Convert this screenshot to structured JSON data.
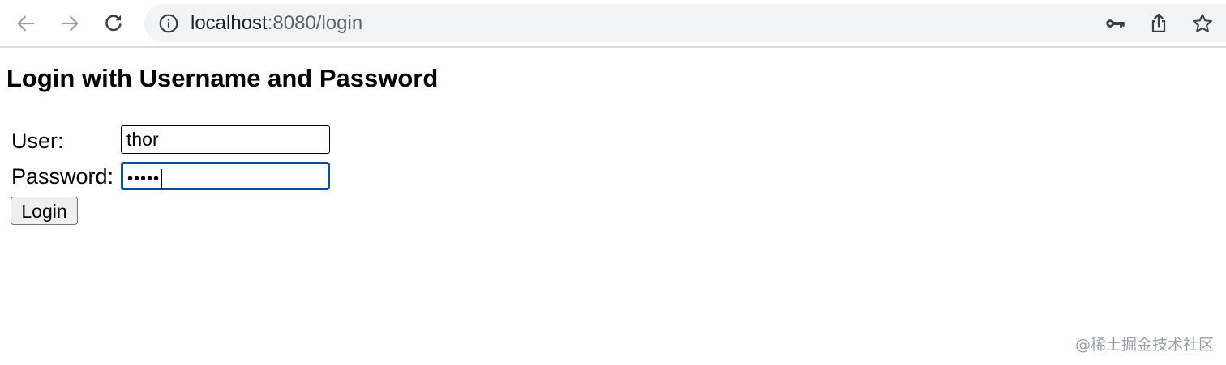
{
  "browser": {
    "url_host": "localhost",
    "url_rest": ":8080/login",
    "icons": {
      "back": "arrow-left-icon",
      "forward": "arrow-right-icon",
      "reload": "reload-icon",
      "site_info": "info-icon",
      "password_key": "key-icon",
      "share": "share-icon",
      "bookmark": "star-icon"
    }
  },
  "page": {
    "title": "Login with Username and Password"
  },
  "form": {
    "user_label": "User:",
    "user_value": "thor",
    "password_label": "Password:",
    "password_masked": "•••••",
    "login_label": "Login"
  },
  "watermark": "@稀土掘金技术社区",
  "colors": {
    "focus_ring": "#0b4fa3",
    "omnibox_bg": "#f1f3f4",
    "button_bg": "#efefef"
  }
}
